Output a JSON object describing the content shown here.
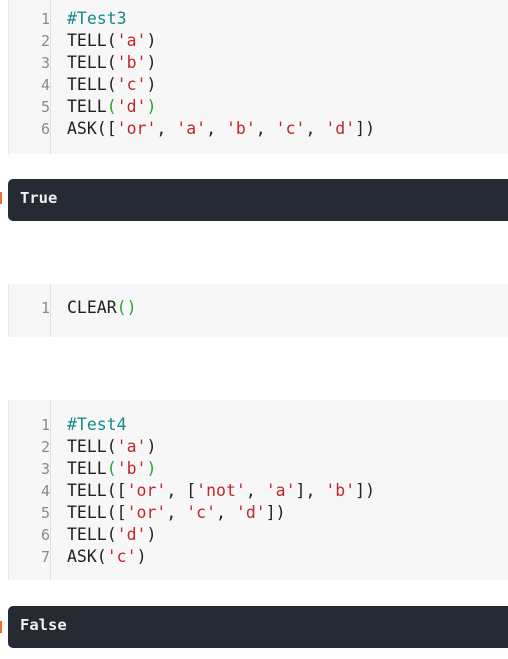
{
  "cells": [
    {
      "lines": [
        [
          {
            "t": "#Test3",
            "c": "comment"
          }
        ],
        [
          {
            "t": "TELL("
          },
          {
            "t": "'a'",
            "c": "str"
          },
          {
            "t": ")"
          }
        ],
        [
          {
            "t": "TELL("
          },
          {
            "t": "'b'",
            "c": "str"
          },
          {
            "t": ")"
          }
        ],
        [
          {
            "t": "TELL("
          },
          {
            "t": "'c'",
            "c": "str"
          },
          {
            "t": ")"
          }
        ],
        [
          {
            "t": "TELL",
            "c": "kw"
          },
          {
            "t": "(",
            "c": "paren-g"
          },
          {
            "t": "'d'",
            "c": "str"
          },
          {
            "t": ")",
            "c": "paren-g"
          }
        ],
        [
          {
            "t": "ASK(["
          },
          {
            "t": "'or'",
            "c": "str"
          },
          {
            "t": ", "
          },
          {
            "t": "'a'",
            "c": "str"
          },
          {
            "t": ", "
          },
          {
            "t": "'b'",
            "c": "str"
          },
          {
            "t": ", "
          },
          {
            "t": "'c'",
            "c": "str"
          },
          {
            "t": ", "
          },
          {
            "t": "'d'",
            "c": "str"
          },
          {
            "t": "])"
          }
        ]
      ],
      "output": "True"
    },
    {
      "lines": [
        [
          {
            "t": "CLEAR",
            "c": "kw"
          },
          {
            "t": "()",
            "c": "paren-g"
          }
        ]
      ],
      "output": null
    },
    {
      "lines": [
        [
          {
            "t": "#Test4",
            "c": "comment"
          }
        ],
        [
          {
            "t": "TELL("
          },
          {
            "t": "'a'",
            "c": "str"
          },
          {
            "t": ")"
          }
        ],
        [
          {
            "t": "TELL",
            "c": "kw"
          },
          {
            "t": "(",
            "c": "paren-g"
          },
          {
            "t": "'b'",
            "c": "str"
          },
          {
            "t": ")",
            "c": "paren-g"
          }
        ],
        [
          {
            "t": "TELL(["
          },
          {
            "t": "'or'",
            "c": "str"
          },
          {
            "t": ", ["
          },
          {
            "t": "'not'",
            "c": "str"
          },
          {
            "t": ", "
          },
          {
            "t": "'a'",
            "c": "str"
          },
          {
            "t": "], "
          },
          {
            "t": "'b'",
            "c": "str"
          },
          {
            "t": "])"
          }
        ],
        [
          {
            "t": "TELL(["
          },
          {
            "t": "'or'",
            "c": "str"
          },
          {
            "t": ", "
          },
          {
            "t": "'c'",
            "c": "str"
          },
          {
            "t": ", "
          },
          {
            "t": "'d'",
            "c": "str"
          },
          {
            "t": "])"
          }
        ],
        [
          {
            "t": "TELL("
          },
          {
            "t": "'d'",
            "c": "str"
          },
          {
            "t": ")"
          }
        ],
        [
          {
            "t": "ASK("
          },
          {
            "t": "'c'",
            "c": "str"
          },
          {
            "t": ")"
          }
        ]
      ],
      "output": "False"
    }
  ],
  "colors": {
    "comment": "#178a8a",
    "string": "#c0262d",
    "paren_highlight": "#2aa52a",
    "output_bg": "#252a33",
    "output_marker": "#e8742d"
  }
}
